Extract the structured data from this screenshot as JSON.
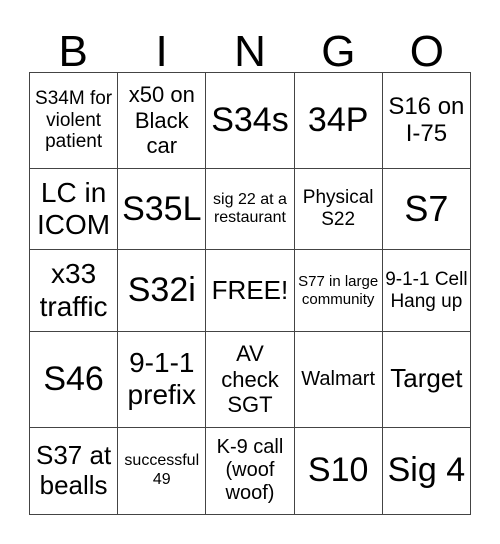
{
  "header": [
    "B",
    "I",
    "N",
    "G",
    "O"
  ],
  "cells": [
    [
      {
        "t": "S34M for violent patient",
        "s": 19
      },
      {
        "t": "x50 on Black car",
        "s": 22
      },
      {
        "t": "S34s",
        "s": 34
      },
      {
        "t": "34P",
        "s": 34
      },
      {
        "t": "S16 on I-75",
        "s": 24
      }
    ],
    [
      {
        "t": "LC in ICOM",
        "s": 28
      },
      {
        "t": "S35L",
        "s": 34
      },
      {
        "t": "sig 22 at a restaurant",
        "s": 16
      },
      {
        "t": "Physical S22",
        "s": 19
      },
      {
        "t": "S7",
        "s": 36
      }
    ],
    [
      {
        "t": "x33 traffic",
        "s": 28
      },
      {
        "t": "S32i",
        "s": 34
      },
      {
        "t": "FREE!",
        "s": 26
      },
      {
        "t": "S77 in large community",
        "s": 15
      },
      {
        "t": "9-1-1 Cell Hang up",
        "s": 19
      }
    ],
    [
      {
        "t": "S46",
        "s": 34
      },
      {
        "t": "9-1-1 prefix",
        "s": 28
      },
      {
        "t": "AV check SGT",
        "s": 22
      },
      {
        "t": "Walmart",
        "s": 20
      },
      {
        "t": "Target",
        "s": 26
      }
    ],
    [
      {
        "t": "S37 at bealls",
        "s": 26
      },
      {
        "t": "successful 49",
        "s": 16
      },
      {
        "t": "K-9 call (woof woof)",
        "s": 20
      },
      {
        "t": "S10",
        "s": 34
      },
      {
        "t": "Sig 4",
        "s": 34
      }
    ]
  ]
}
